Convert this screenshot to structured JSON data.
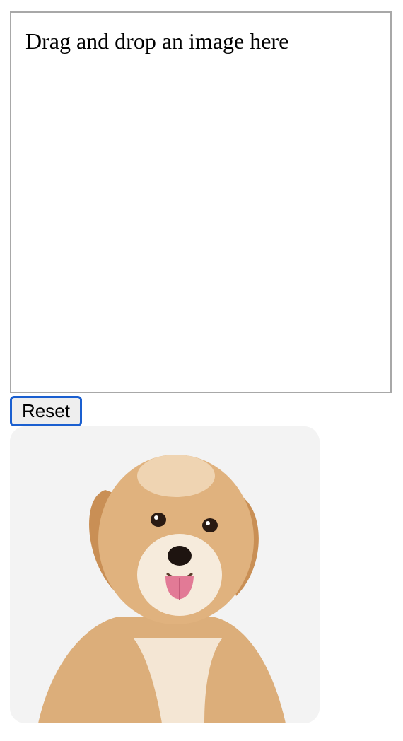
{
  "drop_zone": {
    "text": "Drag and drop an image here"
  },
  "reset_button": {
    "label": "Reset"
  },
  "image": {
    "subject": "dog-photo",
    "background_color": "#f3f3f3",
    "fur_color": "#d9a56c",
    "fur_light_color": "#f3e2cc",
    "tongue_color": "#e27a96"
  },
  "colors": {
    "focus_ring": "#1a5fd0",
    "drop_zone_border": "#a8a8a8"
  }
}
